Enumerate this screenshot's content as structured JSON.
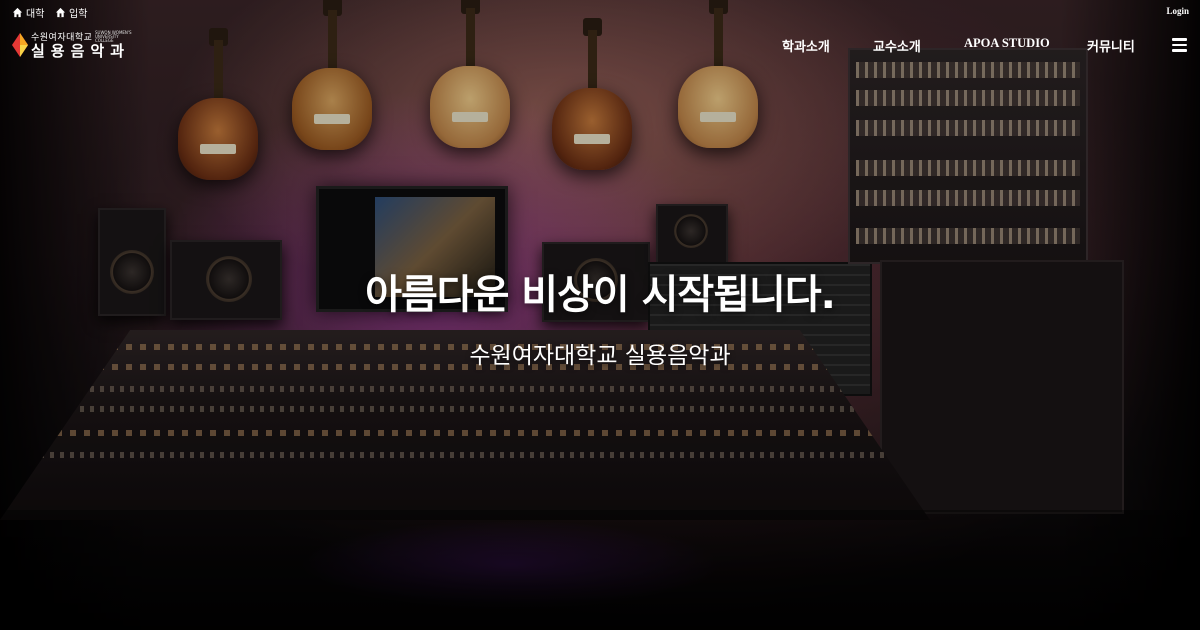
{
  "topbar": {
    "links": [
      {
        "label": "대학",
        "icon": "home-icon"
      },
      {
        "label": "입학",
        "icon": "graduation-cap-icon"
      }
    ],
    "login_label": "Login"
  },
  "logo": {
    "school": "수원여자대학교",
    "school_en": "SUWON WOMEN'S UNIVERSITY COLLEGE",
    "dept": "실용음악과",
    "colors": {
      "red": "#e53935",
      "orange": "#f5a623",
      "yellow": "#f8d347"
    }
  },
  "nav": {
    "items": [
      "학과소개",
      "교수소개",
      "APOA STUDIO",
      "커뮤니티"
    ],
    "menu_icon": "hamburger-menu-icon"
  },
  "hero": {
    "title": "아름다운 비상이 시작됩니다.",
    "subtitle": "수원여자대학교 실용음악과"
  }
}
